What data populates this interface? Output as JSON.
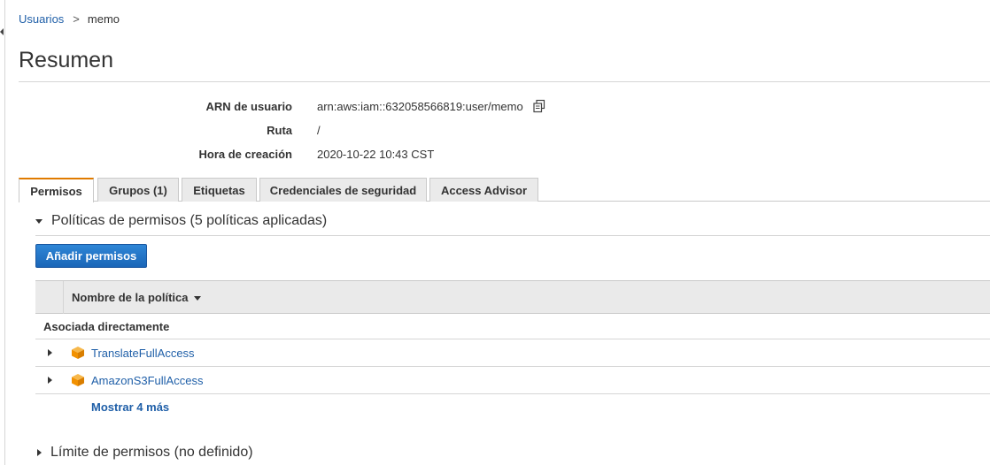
{
  "breadcrumb": {
    "parent": "Usuarios",
    "separator": ">",
    "current": "memo"
  },
  "page": {
    "title": "Resumen"
  },
  "summary": {
    "arn_label": "ARN de usuario",
    "arn_value": "arn:aws:iam::632058566819:user/memo",
    "path_label": "Ruta",
    "path_value": "/",
    "created_label": "Hora de creación",
    "created_value": "2020-10-22 10:43 CST"
  },
  "tabs": [
    {
      "label": "Permisos",
      "active": true
    },
    {
      "label": "Grupos (1)",
      "active": false
    },
    {
      "label": "Etiquetas",
      "active": false
    },
    {
      "label": "Credenciales de seguridad",
      "active": false
    },
    {
      "label": "Access Advisor",
      "active": false
    }
  ],
  "permissions": {
    "section_title": "Políticas de permisos (5 políticas aplicadas)",
    "add_button": "Añadir permisos",
    "column_policy_name": "Nombre de la política",
    "group_label": "Asociada directamente",
    "policies": [
      {
        "name": "TranslateFullAccess",
        "icon": "aws-managed-policy-icon"
      },
      {
        "name": "AmazonS3FullAccess",
        "icon": "aws-managed-policy-icon"
      }
    ],
    "show_more": "Mostrar 4 más"
  },
  "boundary": {
    "section_title": "Límite de permisos (no definido)"
  },
  "colors": {
    "link": "#1f5fa8",
    "primary_button": "#1a66b8",
    "active_tab_accent": "#e07b00",
    "policy_icon": "#f29100"
  }
}
